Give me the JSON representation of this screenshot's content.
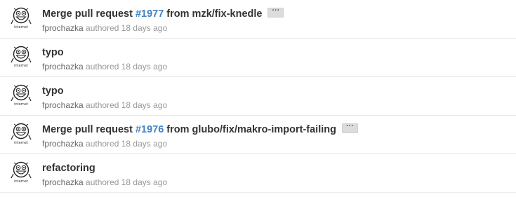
{
  "commits": [
    {
      "title_prefix": "Merge pull request ",
      "pr_number": "#1977",
      "title_suffix": " from mzk/fix-knedle",
      "has_ellipsis": true,
      "ellipsis": "···",
      "author": "fprochazka",
      "action": " authored ",
      "time": "18 days ago"
    },
    {
      "title_prefix": "typo",
      "pr_number": "",
      "title_suffix": "",
      "has_ellipsis": false,
      "ellipsis": "",
      "author": "fprochazka",
      "action": " authored ",
      "time": "18 days ago"
    },
    {
      "title_prefix": "typo",
      "pr_number": "",
      "title_suffix": "",
      "has_ellipsis": false,
      "ellipsis": "",
      "author": "fprochazka",
      "action": " authored ",
      "time": "18 days ago"
    },
    {
      "title_prefix": "Merge pull request ",
      "pr_number": "#1976",
      "title_suffix": " from glubo/fix/makro-import-failing",
      "has_ellipsis": true,
      "ellipsis": "···",
      "author": "fprochazka",
      "action": " authored ",
      "time": "18 days ago"
    },
    {
      "title_prefix": "refactoring",
      "pr_number": "",
      "title_suffix": "",
      "has_ellipsis": false,
      "ellipsis": "",
      "author": "fprochazka",
      "action": " authored ",
      "time": "18 days ago"
    }
  ],
  "avatar_caption": "internet",
  "colors": {
    "link": "#4183c4",
    "title": "#333333",
    "meta": "#999999",
    "divider": "#e5e5e5"
  }
}
